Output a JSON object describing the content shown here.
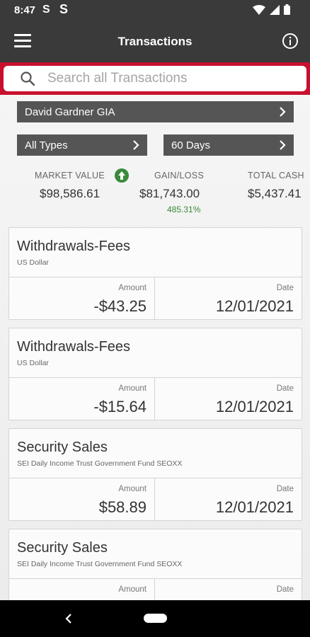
{
  "status": {
    "time": "8:47",
    "icon1": "S",
    "icon2": "S"
  },
  "appbar": {
    "title": "Transactions",
    "menu_icon": "hamburger-menu-icon",
    "info_icon": "info-icon"
  },
  "search": {
    "placeholder": "Search all Transactions"
  },
  "filters": {
    "account": "David Gardner GIA",
    "types": "All Types",
    "period": "60 Days"
  },
  "summary": {
    "market_value_label": "MARKET VALUE",
    "market_value": "$98,586.61",
    "gain_loss_label": "GAIN/LOSS",
    "gain_loss": "$81,743.00",
    "gain_loss_pct": "485.31%",
    "total_cash_label": "TOTAL CASH",
    "total_cash": "$5,437.41",
    "positive_color": "#3a8a3a"
  },
  "transactions": [
    {
      "title": "Withdrawals-Fees",
      "subtitle": "US Dollar",
      "amount_label": "Amount",
      "amount": "-$43.25",
      "date_label": "Date",
      "date": "12/01/2021"
    },
    {
      "title": "Withdrawals-Fees",
      "subtitle": "US Dollar",
      "amount_label": "Amount",
      "amount": "-$15.64",
      "date_label": "Date",
      "date": "12/01/2021"
    },
    {
      "title": "Security Sales",
      "subtitle": "SEI Daily Income Trust Government Fund SEOXX",
      "amount_label": "Amount",
      "amount": "$58.89",
      "date_label": "Date",
      "date": "12/01/2021"
    },
    {
      "title": "Security Sales",
      "subtitle": "SEI Daily Income Trust Government Fund SEOXX",
      "amount_label": "Amount",
      "amount": "",
      "date_label": "Date",
      "date": ""
    }
  ],
  "colors": {
    "header": "#3a3a3a",
    "accent": "#c8102e",
    "selector": "#555555"
  }
}
